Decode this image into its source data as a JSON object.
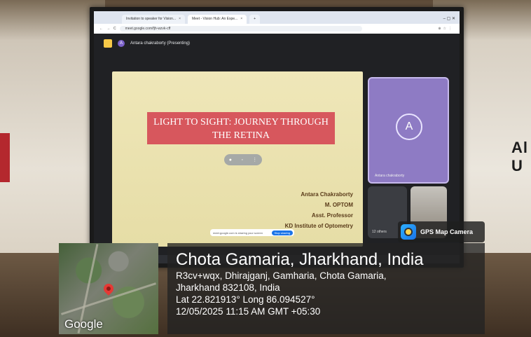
{
  "browser": {
    "tabs": [
      {
        "label": "Invitation to speaker for Vision..."
      },
      {
        "label": "Meet - Vision Hub: An Expe..."
      }
    ],
    "url": "meet.google.com/fjh-wzvk-cff"
  },
  "meet": {
    "presenter_initial": "A",
    "presenter_label": "Antara chakraborty (Presenting)",
    "tile_initial": "A",
    "tile_name": "Antara chakraborty",
    "others_label": "12 others"
  },
  "slide": {
    "title_line1": "LIGHT TO SIGHT: JOURNEY THROUGH",
    "title_line2": "THE RETINA",
    "name": "Antara Chakraborty",
    "degree": "M. OPTOM",
    "position": "Asst. Professor",
    "institute": "KD Institute of Optometry",
    "share_text": "meet.google.com is sharing your screen",
    "share_button": "Stop sharing"
  },
  "wall": {
    "letters_line1": "Al",
    "letters_line2": "U"
  },
  "gps": {
    "badge": "GPS Map Camera",
    "place": "Chota Gamaria, Jharkhand, India",
    "address_line1": "R3cv+wqx, Dhirajganj, Gamharia, Chota Gamaria,",
    "address_line2": "Jharkhand 832108, India",
    "coords": "Lat 22.821913° Long 86.094527°",
    "datetime": "12/05/2025 11:15 AM GMT +05:30",
    "map_logo": "Google"
  }
}
